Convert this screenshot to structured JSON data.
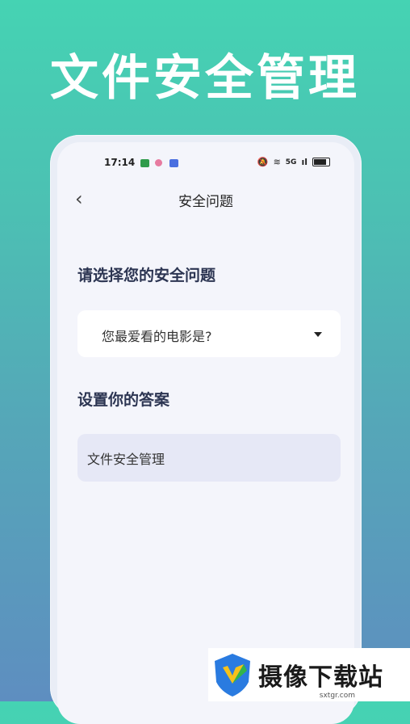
{
  "banner": {
    "title": "文件安全管理"
  },
  "status_bar": {
    "time": "17:14",
    "network": "5G"
  },
  "nav": {
    "title": "安全问题",
    "back_icon": "chevron-left-icon"
  },
  "question": {
    "label": "请选择您的安全问题",
    "selected": "您最爱看的电影是?"
  },
  "answer": {
    "label": "设置你的答案",
    "value": "文件安全管理"
  },
  "watermark": {
    "text": "摄像下载站",
    "url": "sxtgr.com"
  },
  "colors": {
    "accent_top": "#45d3b3",
    "accent_bottom": "#5e8ec0",
    "heading": "#2c3552",
    "input_bg": "#e6e8f6"
  }
}
